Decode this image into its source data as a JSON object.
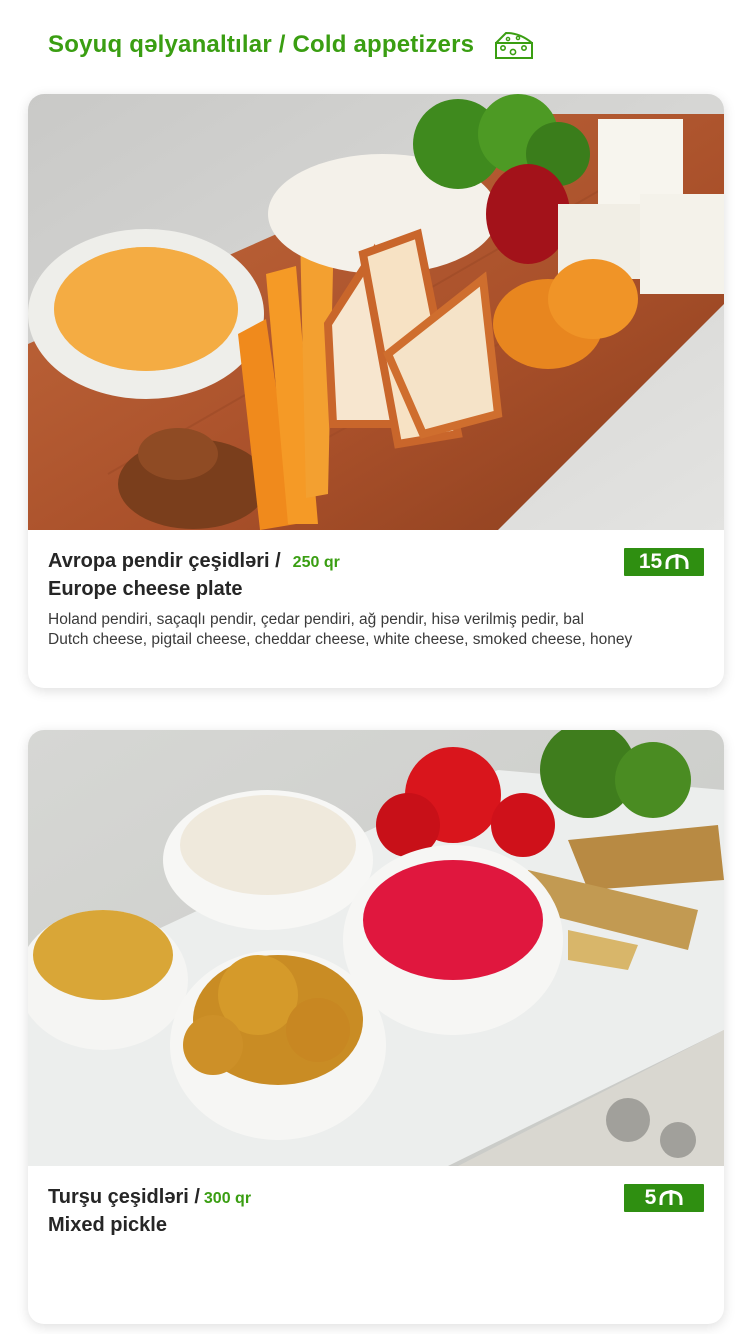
{
  "header": {
    "title": "Soyuq qəlyanaltılar / Cold appetizers",
    "icon": "cheese-icon",
    "color": "#3a9e12"
  },
  "items": [
    {
      "title_az": "Avropa pendir çeşidləri /",
      "weight": "250 qr",
      "title_en": "Europe cheese plate",
      "price": "15",
      "currency_icon": "manat-icon",
      "description_az": "Holand pendiri, saçaqlı pendir, çedar pendiri, ağ pendir, hisə verilmiş pedir, bal",
      "description_en": "Dutch cheese, pigtail cheese, cheddar cheese, white cheese, smoked cheese, honey"
    },
    {
      "title_az": "Turşu çeşidləri /",
      "weight": "300 qr",
      "title_en": "Mixed pickle",
      "price": "5",
      "currency_icon": "manat-icon"
    }
  ],
  "colors": {
    "accent": "#3a9e12",
    "badge": "#2f8f11"
  }
}
